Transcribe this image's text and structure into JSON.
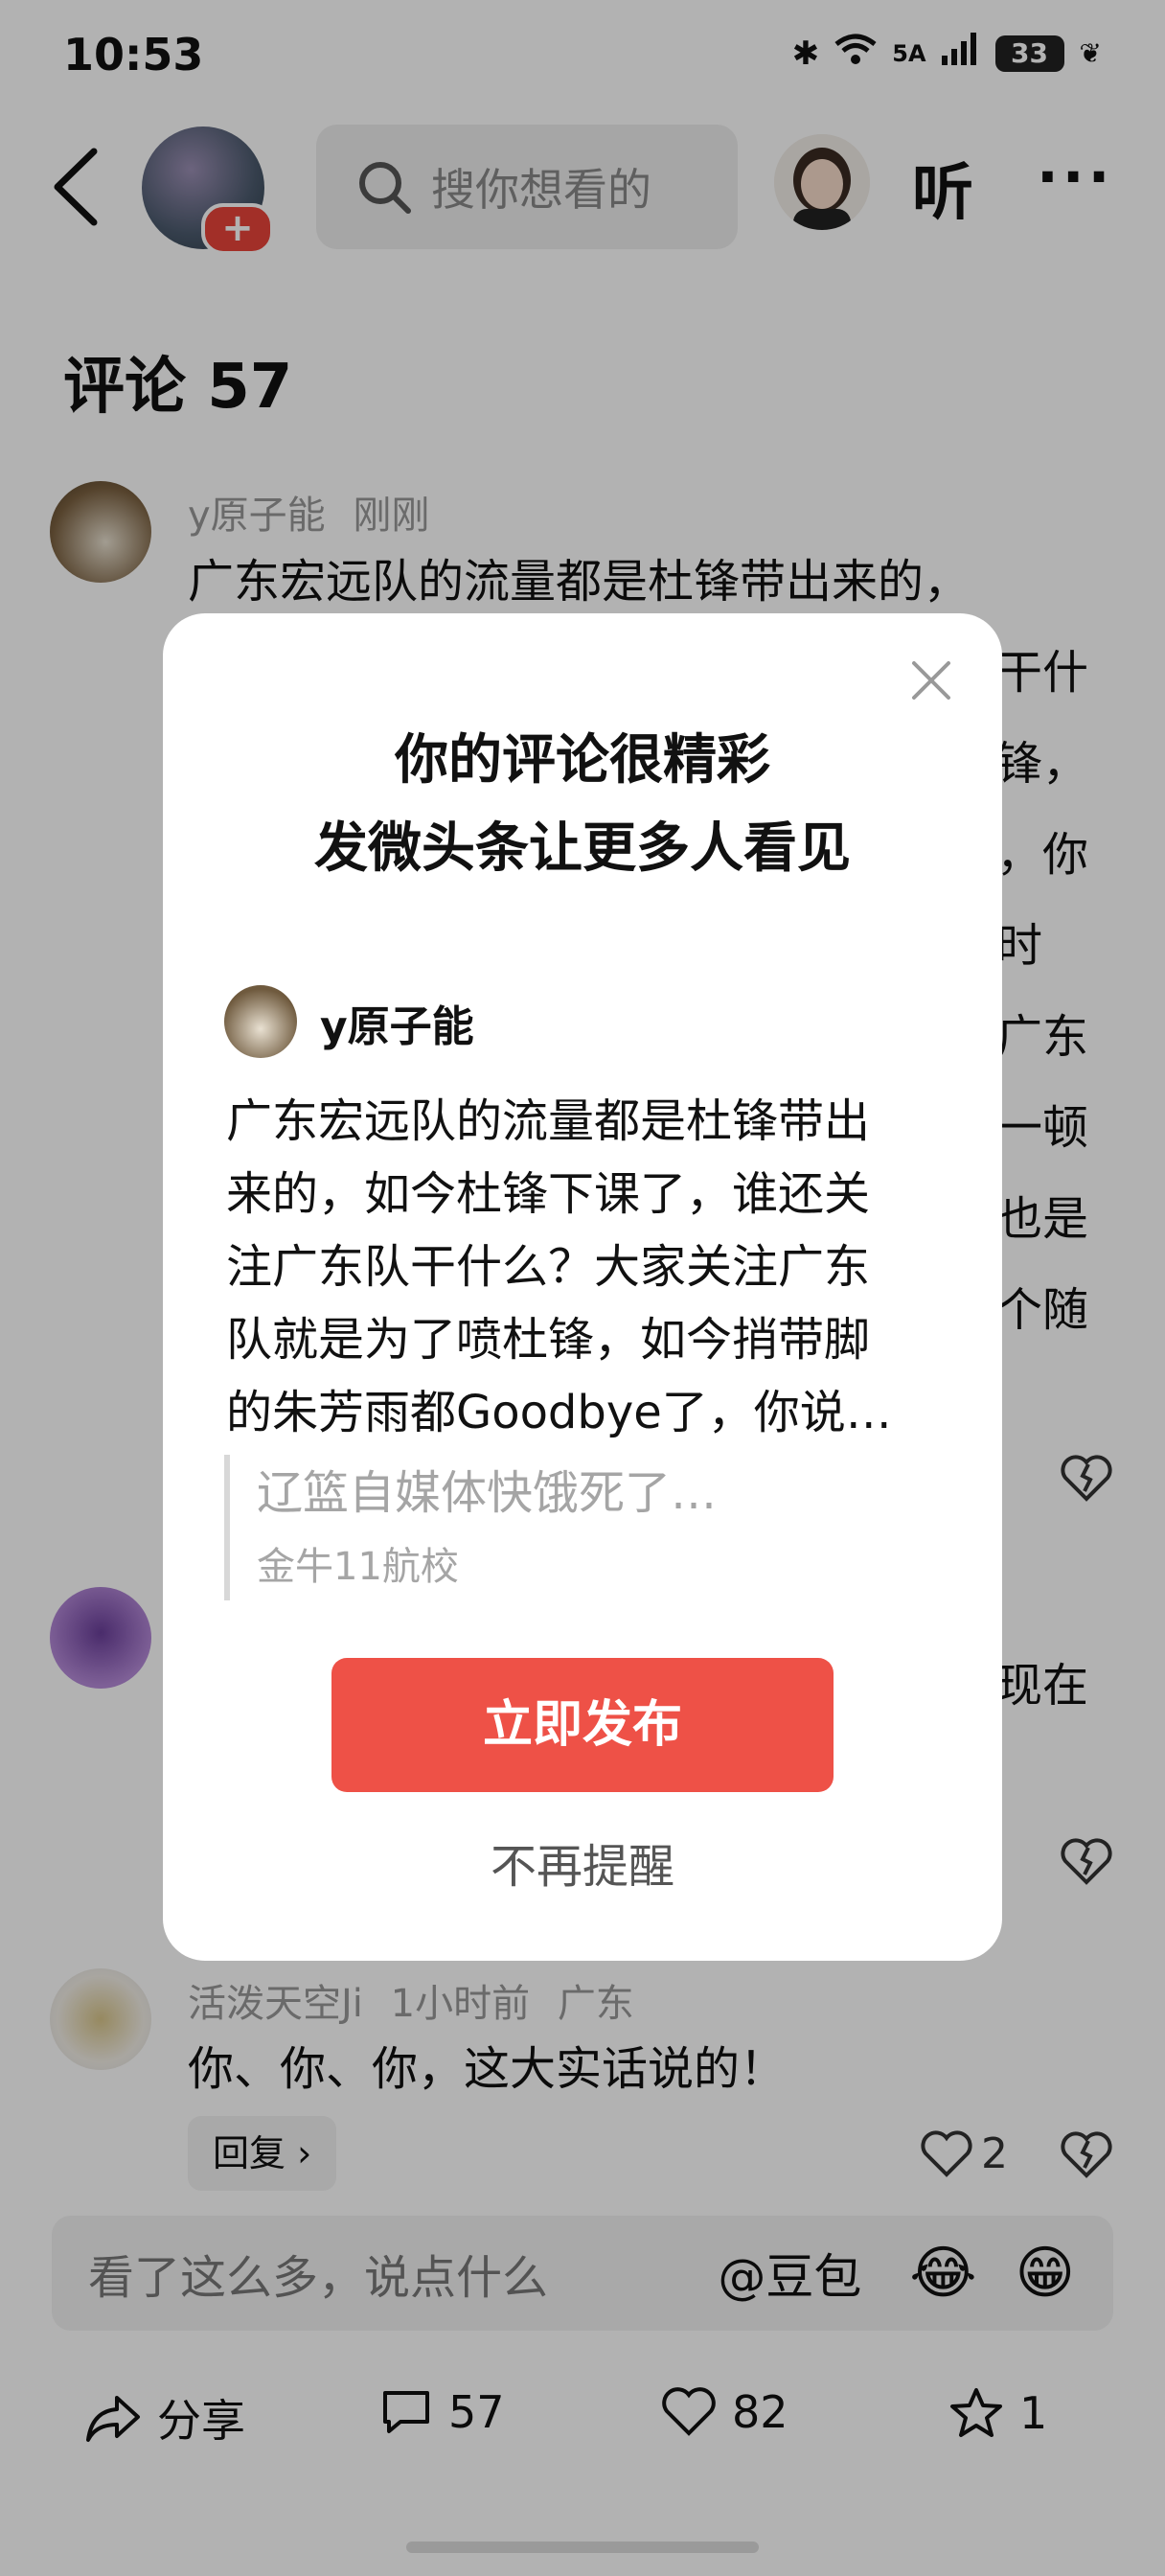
{
  "status_bar": {
    "time": "10:53",
    "network": "5A",
    "battery": "33"
  },
  "header": {
    "search_placeholder": "搜你想看的",
    "listen_label": "听",
    "more_label": "···"
  },
  "comments_header": {
    "title": "评论 57"
  },
  "comments": [
    {
      "user": "y原子能",
      "time": "刚刚",
      "lines": [
        "广东宏远队的流量都是杜锋带出来的，",
        "干什",
        "锋，",
        "，你",
        "时",
        "广东",
        "一顿",
        "也是",
        "个随"
      ]
    },
    {
      "line": "现在"
    },
    {
      "user": "活泼天空Ji",
      "time": "1小时前",
      "location": "广东",
      "text": "你、你、你，这大实话说的！",
      "reply_label": "回复 ›",
      "likes": "2"
    }
  ],
  "comment_input": {
    "placeholder": "看了这么多，说点什么",
    "doubao": "@豆包"
  },
  "bottom_bar": {
    "share_label": "分享",
    "comment_count": "57",
    "like_count": "82",
    "fav_count": "1"
  },
  "dialog": {
    "title_line1": "你的评论很精彩",
    "title_line2": "发微头条让更多人看见",
    "preview_user": "y原子能",
    "preview_lines": [
      "广东宏远队的流量都是杜锋带出",
      "来的，如今杜锋下课了，谁还关",
      "注广东队干什么？大家关注广东",
      "队就是为了喷杜锋，如今捎带脚",
      "的朱芳雨都Goodbye了，你说…"
    ],
    "quote_text": "辽篮自媒体快饿死了…",
    "quote_user": "金牛11航校",
    "publish_label": "立即发布",
    "no_remind_label": "不再提醒"
  }
}
